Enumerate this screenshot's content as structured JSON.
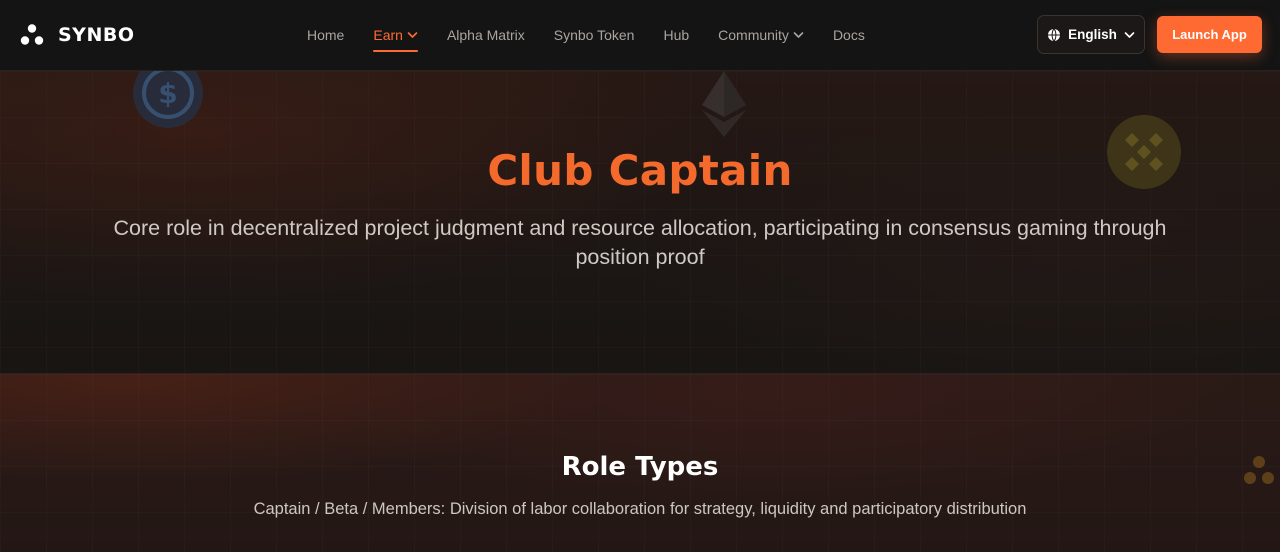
{
  "brand": {
    "name": "SYNBO"
  },
  "nav": {
    "items": [
      {
        "label": "Home"
      },
      {
        "label": "Earn"
      },
      {
        "label": "Alpha Matrix"
      },
      {
        "label": "Synbo Token"
      },
      {
        "label": "Hub"
      },
      {
        "label": "Community"
      },
      {
        "label": "Docs"
      }
    ],
    "language": "English",
    "launch_label": "Launch App"
  },
  "hero": {
    "title": "Club Captain",
    "subtitle": "Core role in decentralized project judgment and resource allocation, participating in consensus gaming through position proof"
  },
  "role_types": {
    "title": "Role Types",
    "subtitle": "Captain / Beta / Members: Division of labor collaboration for strategy, liquidity and participatory distribution"
  },
  "icons": {
    "logo": "synbo-logo-icon",
    "globe": "globe-icon",
    "usdc": "usdc-coin-icon",
    "eth": "ethereum-icon",
    "bnb": "bnb-coin-icon"
  },
  "colors": {
    "accent": "#ff6a33",
    "hero_title": "#f46a2c",
    "nav_bg": "#141414"
  }
}
